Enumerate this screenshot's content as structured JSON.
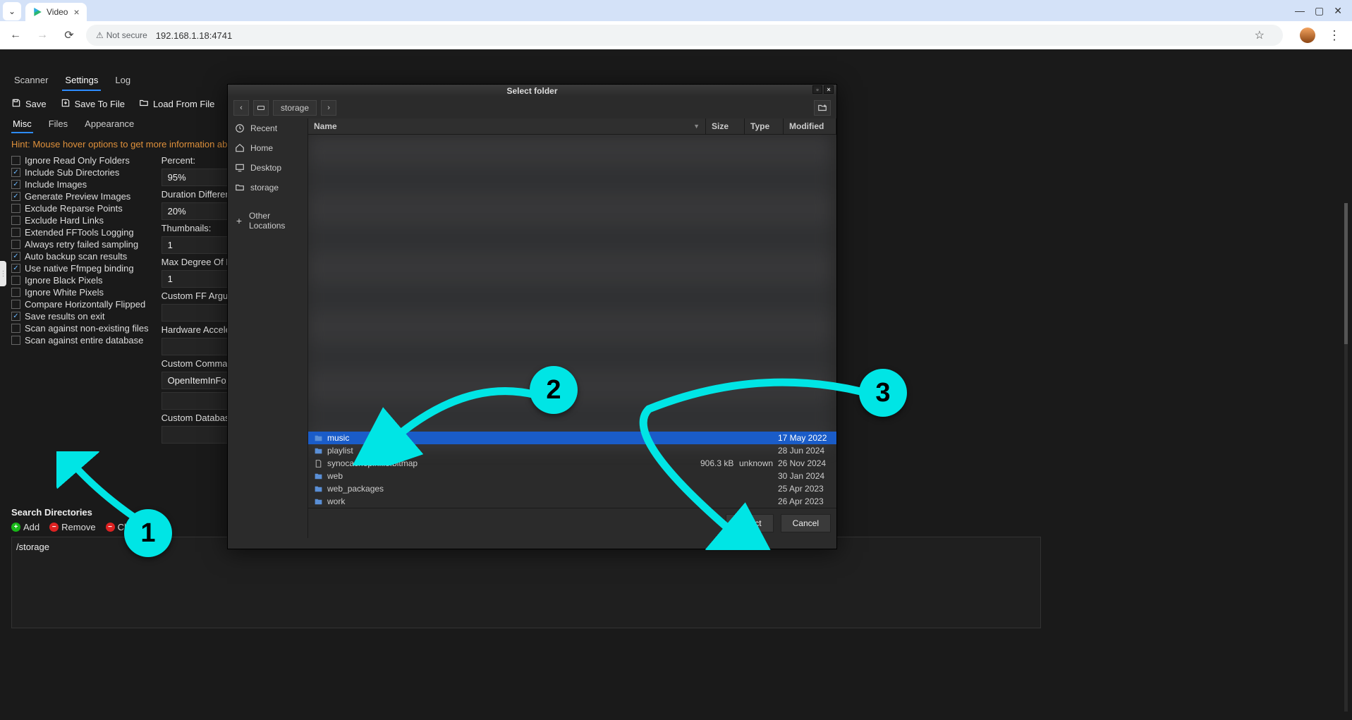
{
  "browser": {
    "tab_title": "Video",
    "url_warning": "Not secure",
    "url": "192.168.1.18:4741"
  },
  "app": {
    "tabs": [
      "Scanner",
      "Settings",
      "Log"
    ],
    "active_tab": 1,
    "actions": {
      "save": "Save",
      "save_to_file": "Save To File",
      "load_from_file": "Load From File"
    },
    "sub_tabs": [
      "Misc",
      "Files",
      "Appearance"
    ],
    "active_sub": 0,
    "hint": "Hint: Mouse hover options to get more information ab"
  },
  "checkboxes": [
    {
      "label": "Ignore Read Only Folders",
      "checked": false
    },
    {
      "label": "Include Sub Directories",
      "checked": true
    },
    {
      "label": "Include Images",
      "checked": true
    },
    {
      "label": "Generate Preview Images",
      "checked": true
    },
    {
      "label": "Exclude Reparse Points",
      "checked": false
    },
    {
      "label": "Exclude Hard Links",
      "checked": false
    },
    {
      "label": "Extended FFTools Logging",
      "checked": false
    },
    {
      "label": "Always retry failed sampling",
      "checked": false
    },
    {
      "label": "Auto backup scan results",
      "checked": true
    },
    {
      "label": "Use native Ffmpeg binding",
      "checked": true
    },
    {
      "label": "Ignore Black Pixels",
      "checked": false
    },
    {
      "label": "Ignore White Pixels",
      "checked": false
    },
    {
      "label": "Compare Horizontally Flipped",
      "checked": false
    },
    {
      "label": "Save results on exit",
      "checked": true
    },
    {
      "label": "Scan against non-existing files",
      "checked": false
    },
    {
      "label": "Scan against entire database",
      "checked": false
    }
  ],
  "fields": {
    "percent_label": "Percent:",
    "percent_value": "95%",
    "duration_label": "Duration Differenc",
    "duration_value": "20%",
    "thumbnails_label": "Thumbnails:",
    "thumbnails_value": "1",
    "maxpar_label": "Max Degree Of Pa",
    "maxpar_value": "1",
    "customff_label": "Custom FF Argum",
    "hwaccel_label": "Hardware Acceler",
    "customcmd_label": "Custom Command",
    "customcmd_value": "OpenItemInFold",
    "customdb_label": "Custom Database"
  },
  "search_dirs": {
    "title": "Search Directories",
    "add": "Add",
    "remove": "Remove",
    "clear": "Clear All",
    "entries": [
      "/storage"
    ]
  },
  "dialog": {
    "title": "Select folder",
    "breadcrumb": "storage",
    "places": [
      "Recent",
      "Home",
      "Desktop",
      "storage",
      "Other Locations"
    ],
    "headers": {
      "name": "Name",
      "size": "Size",
      "type": "Type",
      "modified": "Modified"
    },
    "rows": [
      {
        "name": "music",
        "size": "",
        "type": "",
        "modified": "17 May 2022",
        "kind": "folder",
        "selected": true
      },
      {
        "name": "playlist",
        "size": "",
        "type": "",
        "modified": "28 Jun 2024",
        "kind": "folder"
      },
      {
        "name": "synocachepinfile.bitmap",
        "size": "906.3 kB",
        "type": "unknown",
        "modified": "26 Nov 2024",
        "kind": "file"
      },
      {
        "name": "web",
        "size": "",
        "type": "",
        "modified": "30 Jan 2024",
        "kind": "folder"
      },
      {
        "name": "web_packages",
        "size": "",
        "type": "",
        "modified": "25 Apr 2023",
        "kind": "folder"
      },
      {
        "name": "work",
        "size": "",
        "type": "",
        "modified": "26 Apr 2023",
        "kind": "folder"
      }
    ],
    "buttons": {
      "select": "Select",
      "cancel": "Cancel"
    }
  },
  "annotations": {
    "1": "1",
    "2": "2",
    "3": "3"
  }
}
